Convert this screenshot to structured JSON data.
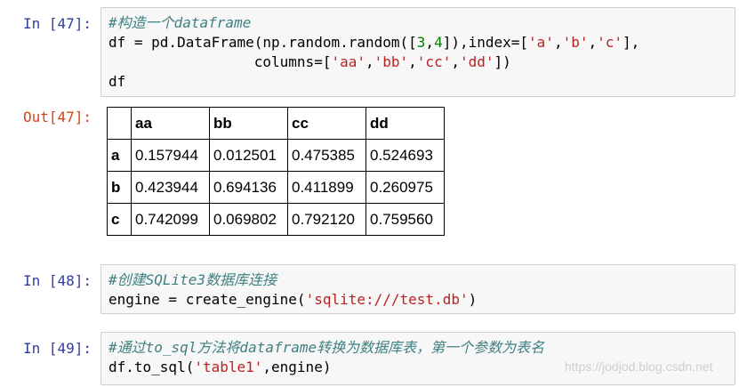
{
  "cells": [
    {
      "prompt": "In [47]:",
      "lines": [
        [
          {
            "t": "#构造一个dataframe",
            "c": "comment"
          }
        ],
        [
          {
            "t": "df = pd.DataFrame(np.random.random(["
          },
          {
            "t": "3",
            "c": "num"
          },
          {
            "t": ","
          },
          {
            "t": "4",
            "c": "num"
          },
          {
            "t": "]),index=["
          },
          {
            "t": "'a'",
            "c": "str"
          },
          {
            "t": ","
          },
          {
            "t": "'b'",
            "c": "str"
          },
          {
            "t": ","
          },
          {
            "t": "'c'",
            "c": "str"
          },
          {
            "t": "],"
          }
        ],
        [
          {
            "t": "                 columns=["
          },
          {
            "t": "'aa'",
            "c": "str"
          },
          {
            "t": ","
          },
          {
            "t": "'bb'",
            "c": "str"
          },
          {
            "t": ","
          },
          {
            "t": "'cc'",
            "c": "str"
          },
          {
            "t": ","
          },
          {
            "t": "'dd'",
            "c": "str"
          },
          {
            "t": "])"
          }
        ],
        [
          {
            "t": "df"
          }
        ]
      ]
    },
    {
      "prompt": "In [48]:",
      "lines": [
        [
          {
            "t": "#创建SQLite3数据库连接",
            "c": "comment"
          }
        ],
        [
          {
            "t": "engine = create_engine("
          },
          {
            "t": "'sqlite:///test.db'",
            "c": "str"
          },
          {
            "t": ")"
          }
        ]
      ]
    },
    {
      "prompt": "In [49]:",
      "lines": [
        [
          {
            "t": "#通过to_sql方法将dataframe转换为数据库表，第一个参数为表名",
            "c": "comment"
          }
        ],
        [
          {
            "t": "df.to_sql("
          },
          {
            "t": "'table1'",
            "c": "str"
          },
          {
            "t": ",engine)"
          }
        ]
      ]
    }
  ],
  "output": {
    "prompt": "Out[47]:",
    "columns": [
      "",
      "aa",
      "bb",
      "cc",
      "dd"
    ],
    "rows": [
      {
        "index": "a",
        "values": [
          "0.157944",
          "0.012501",
          "0.475385",
          "0.524693"
        ]
      },
      {
        "index": "b",
        "values": [
          "0.423944",
          "0.694136",
          "0.411899",
          "0.260975"
        ]
      },
      {
        "index": "c",
        "values": [
          "0.742099",
          "0.069802",
          "0.792120",
          "0.759560"
        ]
      }
    ]
  },
  "watermark": "https://jodjod.blog.csdn.net"
}
